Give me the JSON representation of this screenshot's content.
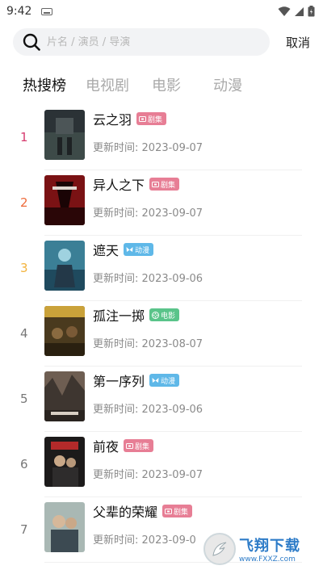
{
  "status": {
    "time": "9:42"
  },
  "search": {
    "placeholder": "片名 / 演员 / 导演",
    "cancel_label": "取消"
  },
  "tabs": [
    {
      "label": "热搜榜",
      "active": true
    },
    {
      "label": "电视剧",
      "active": false
    },
    {
      "label": "电影",
      "active": false
    },
    {
      "label": "动漫",
      "active": false
    }
  ],
  "update_label": "更新时间:",
  "items": [
    {
      "rank": "1",
      "rank_color": "#d63b6e",
      "title": "云之羽",
      "badge": "剧集",
      "badge_color": "#e77e95",
      "date": "2023-09-07"
    },
    {
      "rank": "2",
      "rank_color": "#ee6b3b",
      "title": "异人之下",
      "badge": "剧集",
      "badge_color": "#e77e95",
      "date": "2023-09-07"
    },
    {
      "rank": "3",
      "rank_color": "#f3b33d",
      "title": "遮天",
      "badge": "动漫",
      "badge_color": "#5fb8e8",
      "date": "2023-09-06"
    },
    {
      "rank": "4",
      "rank_color": "#777777",
      "title": "孤注一掷",
      "badge": "电影",
      "badge_color": "#5ac48a",
      "date": "2023-08-07"
    },
    {
      "rank": "5",
      "rank_color": "#777777",
      "title": "第一序列",
      "badge": "动漫",
      "badge_color": "#5fb8e8",
      "date": "2023-09-06"
    },
    {
      "rank": "6",
      "rank_color": "#777777",
      "title": "前夜",
      "badge": "剧集",
      "badge_color": "#e77e95",
      "date": "2023-09-07"
    },
    {
      "rank": "7",
      "rank_color": "#777777",
      "title": "父辈的荣耀",
      "badge": "剧集",
      "badge_color": "#e77e95",
      "date": "2023-09-0"
    }
  ],
  "watermark": {
    "name": "飞翔下载",
    "url": "www.FXXZ.com"
  }
}
